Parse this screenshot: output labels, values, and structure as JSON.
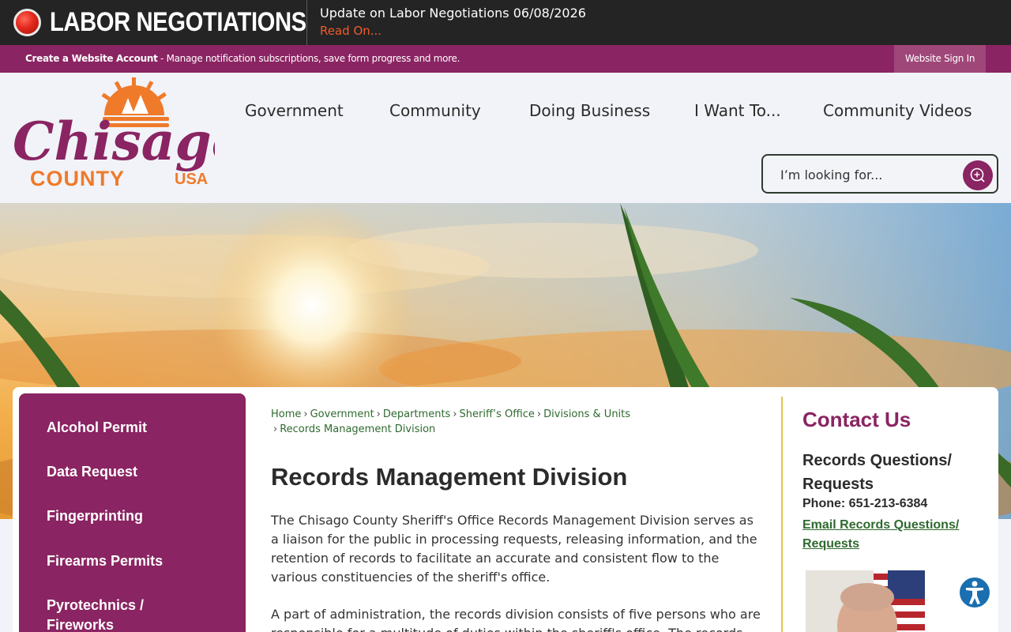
{
  "alert": {
    "title": "LABOR NEGOTIATIONS",
    "headline": "Update on Labor Negotiations 06/08/2026",
    "link": "Read On..."
  },
  "account": {
    "create_label": "Create a Website Account",
    "create_desc": " - Manage notification subscriptions, save form progress and more.",
    "signin": "Website Sign In"
  },
  "logo": {
    "script": "Chisago",
    "county": "COUNTY",
    "usa": "USA"
  },
  "nav": {
    "items": [
      "Government",
      "Community",
      "Doing Business",
      "I Want To...",
      "Community Videos"
    ]
  },
  "search": {
    "placeholder": "I’m looking for..."
  },
  "sidenav": {
    "items": [
      "Alcohol Permit",
      "Data Request",
      "Fingerprinting",
      "Firearms Permits",
      "Pyrotechnics / Fireworks"
    ]
  },
  "breadcrumb": {
    "items": [
      "Home",
      "Government",
      "Departments",
      "Sheriff’s Office",
      "Divisions & Units",
      "Records Management Division"
    ]
  },
  "main": {
    "title": "Records Management Division",
    "para1": "The Chisago County Sheriff's Office Records Management Division serves as a liaison for the public in processing requests, releasing information, and the retention of records to facilitate an accurate and consistent flow to the various constituencies of the sheriff's office.",
    "para2": "A part of administration, the records division consists of five persons who are responsible for a multitude of duties within the sheriff's office. The records"
  },
  "contact": {
    "title": "Contact Us",
    "subtitle": "Records Questions/ Requests",
    "phone": "Phone: 651-213-6384",
    "email": "Email Records Questions/ Requests"
  },
  "colors": {
    "brand_purple": "#8a2462",
    "brand_orange": "#ef7a2a",
    "link_green": "#2f6a2f",
    "alert_bg": "#242424",
    "accent_gold": "#e8c54a"
  },
  "icons": {
    "alert": "alert-dot-icon",
    "search": "search-icon",
    "accessibility": "accessibility-icon"
  }
}
